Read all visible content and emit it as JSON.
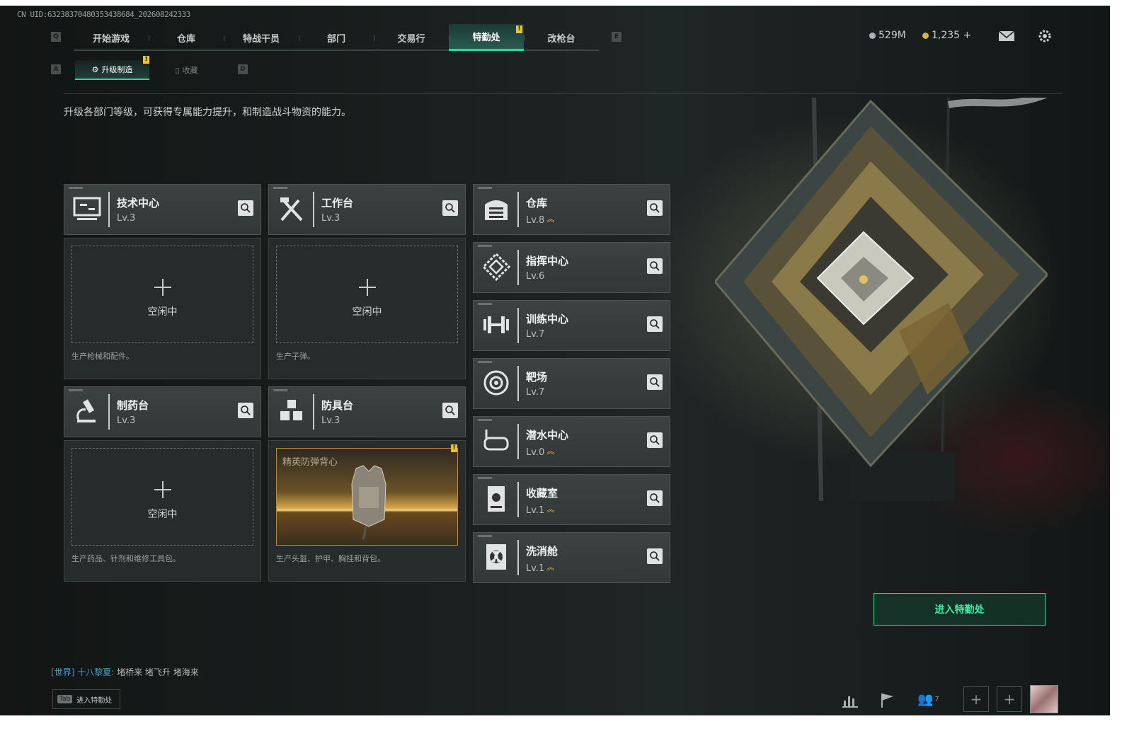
{
  "uid_text": "CN UID:6323837048035343868​4_202608242333",
  "nav": {
    "left_key": "Q",
    "right_key": "E",
    "tabs": [
      {
        "label": "开始游戏"
      },
      {
        "label": "仓库"
      },
      {
        "label": "特战干员"
      },
      {
        "label": "部门"
      },
      {
        "label": "交易行"
      },
      {
        "label": "特勤处",
        "active": true,
        "badge": "!"
      },
      {
        "label": "改枪台"
      }
    ]
  },
  "subnav": {
    "left_key": "A",
    "right_key": "D",
    "tabs": [
      {
        "label": "升级制造",
        "active": true,
        "badge": "!"
      },
      {
        "label": "收藏"
      }
    ]
  },
  "currency": {
    "silver": "529M",
    "gold": "1,235 +"
  },
  "description": "升级各部门等级，可获得专属能力提升，和制造战斗物资的能力。",
  "production": [
    {
      "name": "技术中心",
      "level": "Lv.3",
      "icon": "computer-icon",
      "slot": "空闲中",
      "desc": "生产枪械和配件。"
    },
    {
      "name": "工作台",
      "level": "Lv.3",
      "icon": "tools-icon",
      "slot": "空闲中",
      "desc": "生产子弹。"
    },
    {
      "name": "制药台",
      "level": "Lv.3",
      "icon": "microscope-icon",
      "slot": "空闲中",
      "desc": "生产药品、针剂和维修工具包。"
    },
    {
      "name": "防具台",
      "level": "Lv.3",
      "icon": "blocks-icon",
      "slot_item": "精英防弹背心",
      "badge": "!",
      "desc": "生产头盔、护甲、胸挂和背包。"
    }
  ],
  "facilities": [
    {
      "name": "仓库",
      "level": "Lv.8",
      "upgrade": true,
      "icon": "warehouse-icon"
    },
    {
      "name": "指挥中心",
      "level": "Lv.6",
      "upgrade": false,
      "icon": "command-icon"
    },
    {
      "name": "训练中心",
      "level": "Lv.7",
      "upgrade": false,
      "icon": "dumbbell-icon"
    },
    {
      "name": "靶场",
      "level": "Lv.7",
      "upgrade": false,
      "icon": "target-icon"
    },
    {
      "name": "潜水中心",
      "level": "Lv.0",
      "upgrade": true,
      "icon": "diving-mask-icon"
    },
    {
      "name": "收藏室",
      "level": "Lv.1",
      "upgrade": true,
      "icon": "collection-icon"
    },
    {
      "name": "洗消舱",
      "level": "Lv.1",
      "upgrade": true,
      "icon": "radiation-icon"
    }
  ],
  "enter_button": "进入特勤处",
  "chat": {
    "channel": "[世界]",
    "user": "十八黎夏:",
    "message": "堵桥来 堵飞升 堵海来"
  },
  "tab_hint": {
    "key": "Tab",
    "label": "进入特勤处"
  },
  "friends_count": "7",
  "colors": {
    "accent": "#28d7a0",
    "badge": "#e8c23c",
    "upgrade": "#e6c24a"
  }
}
